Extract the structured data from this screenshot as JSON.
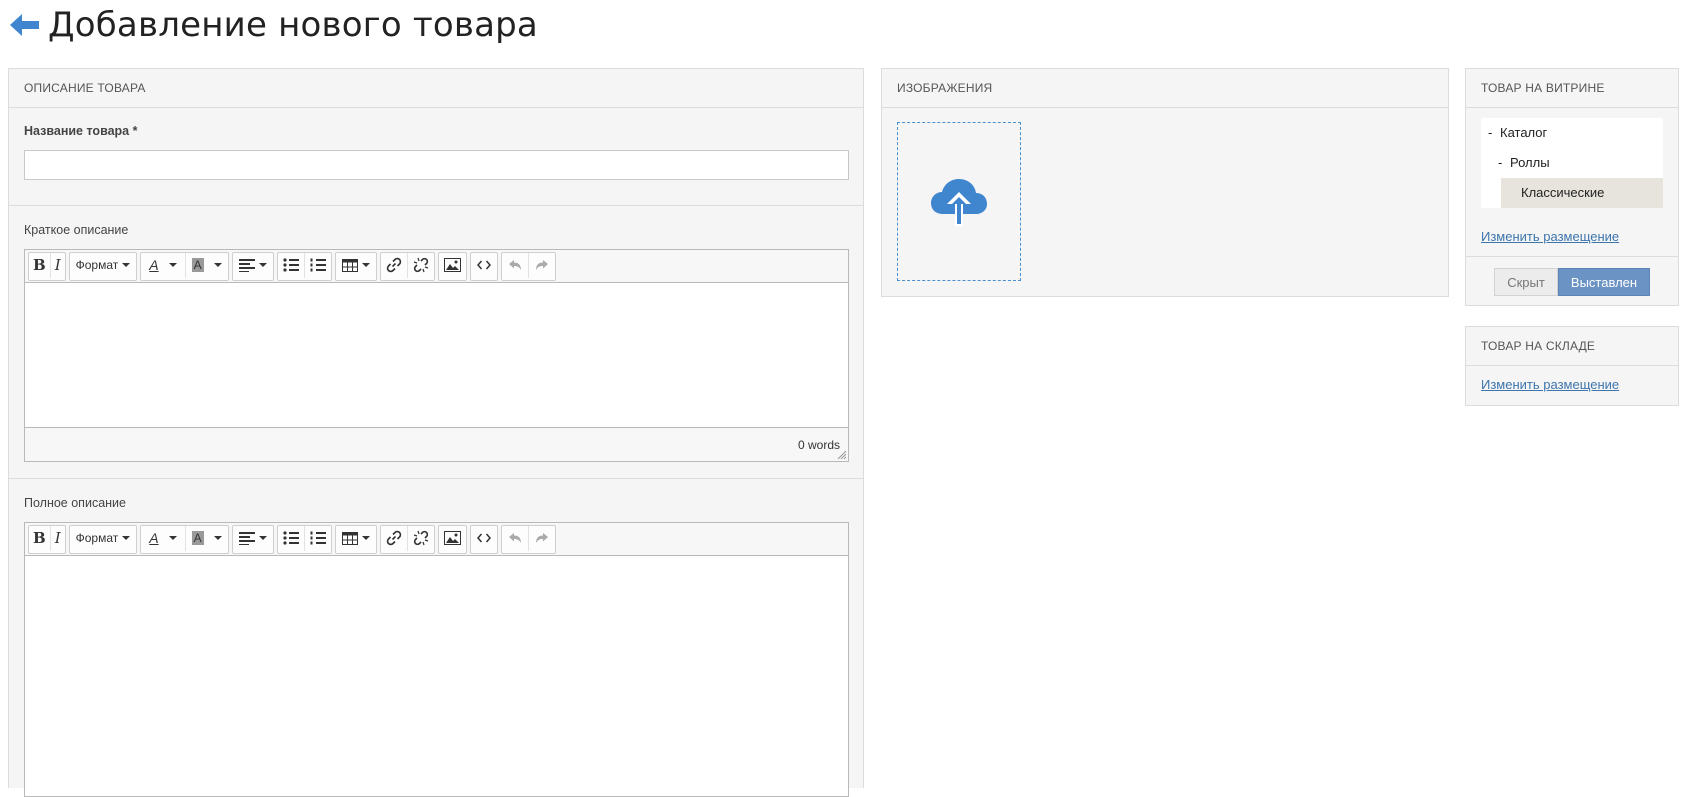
{
  "page": {
    "title": "Добавление нового товара",
    "back_icon": "arrow-left-icon",
    "accent_color": "#3f86cf"
  },
  "description_panel": {
    "header": "ОПИСАНИЕ ТОВАРА",
    "name_label": "Название товара *",
    "name_value": "",
    "short_label": "Краткое описание",
    "full_label": "Полное описание",
    "word_count": "0 words"
  },
  "toolbar": {
    "bold": "B",
    "italic": "I",
    "format_label": "Формат",
    "font_color_letter": "A",
    "bg_color_letter": "A"
  },
  "images_panel": {
    "header": "ИЗОБРАЖЕНИЯ",
    "upload_icon": "cloud-upload-icon"
  },
  "showcase_panel": {
    "header": "ТОВАР НА ВИТРИНЕ",
    "tree": [
      {
        "dash": "-",
        "label": "Каталог"
      },
      {
        "dash": "-",
        "label": "Роллы"
      },
      {
        "dash": "",
        "label": "Классические",
        "selected": true
      }
    ],
    "change_link": "Изменить размещение",
    "hidden_label": "Скрыт",
    "shown_label": "Выставлен",
    "active_state": "Выставлен"
  },
  "stock_panel": {
    "header": "ТОВАР НА СКЛАДЕ",
    "change_link": "Изменить размещение"
  }
}
